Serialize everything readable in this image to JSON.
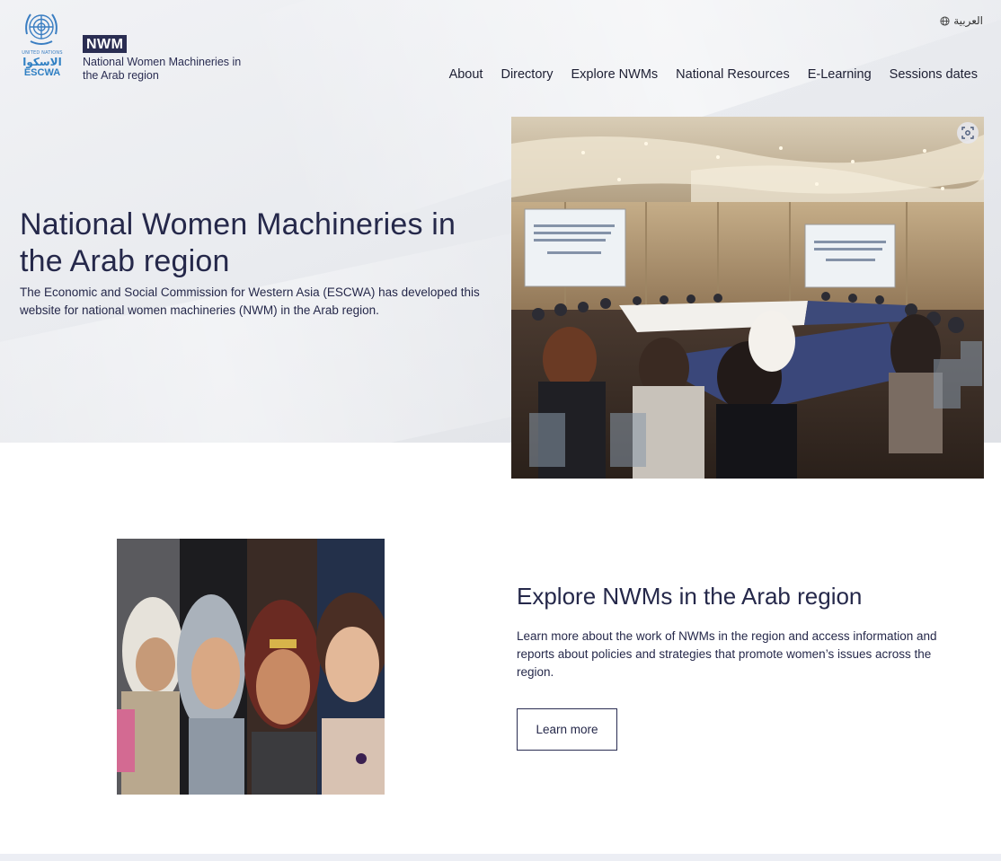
{
  "header": {
    "un_label": "UNITED NATIONS",
    "escwa_ar": "الاسكوا",
    "escwa_en": "ESCWA",
    "badge": "NWM",
    "subtitle": "National Women Machineries in the Arab region",
    "language_switch": "العربية",
    "nav": [
      "About",
      "Directory",
      "Explore NWMs",
      "National Resources",
      "E-Learning",
      "Sessions dates"
    ]
  },
  "hero": {
    "title": "National Women Machineries in the Arab region",
    "description": "The Economic and Social Commission for Western Asia (ESCWA) has developed this website for national women machineries (NWM) in the Arab region."
  },
  "explore": {
    "title": "Explore NWMs in the Arab region",
    "description": "Learn more about the work of NWMs in the region and access information and reports about policies and strategies that promote women’s issues across the region.",
    "button": "Learn more"
  },
  "colors": {
    "brand_navy": "#2a2d52",
    "un_blue": "#2f7fc3",
    "hero_bg": "#e9ebef"
  },
  "icons": [
    "un-emblem-icon",
    "globe-icon",
    "zoom-icon"
  ]
}
